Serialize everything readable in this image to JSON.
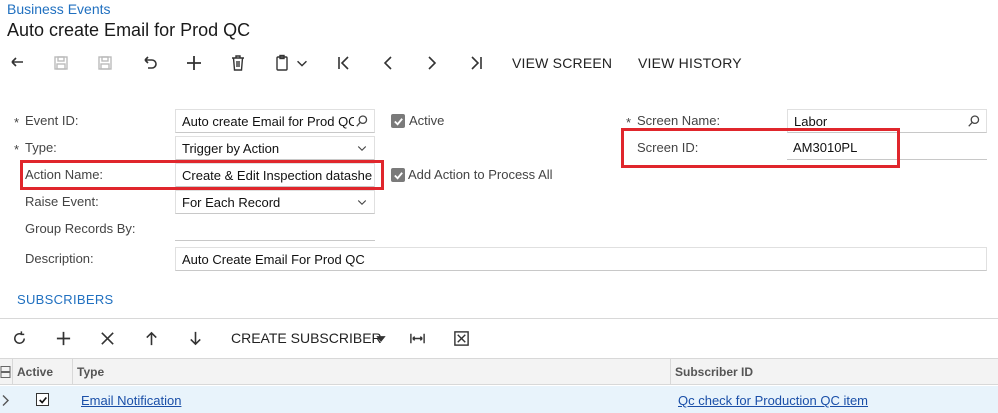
{
  "breadcrumb": "Business Events",
  "title": "Auto create Email for Prod QC",
  "toolbar": {
    "view_screen": "VIEW SCREEN",
    "view_history": "VIEW HISTORY"
  },
  "form": {
    "event_id": {
      "label": "Event ID:",
      "required": "*",
      "value": "Auto create Email for Prod QC"
    },
    "active": {
      "label": "Active",
      "checked": true
    },
    "type": {
      "label": "Type:",
      "required": "*",
      "value": "Trigger by Action"
    },
    "action_name": {
      "label": "Action Name:",
      "value": "Create & Edit Inspection datashe"
    },
    "add_action": {
      "label": "Add Action to Process All",
      "checked": true
    },
    "raise_event": {
      "label": "Raise Event:",
      "value": "For Each Record"
    },
    "group_records_by": {
      "label": "Group Records By:",
      "value": ""
    },
    "description": {
      "label": "Description:",
      "value": "Auto Create Email For Prod QC"
    },
    "screen_name": {
      "label": "Screen Name:",
      "required": "*",
      "value": "Labor"
    },
    "screen_id": {
      "label": "Screen ID:",
      "value": "AM3010PL"
    }
  },
  "tabs": {
    "subscribers": "SUBSCRIBERS"
  },
  "grid_toolbar": {
    "create_subscriber": "CREATE SUBSCRIBER"
  },
  "grid": {
    "columns": {
      "active": "Active",
      "type": "Type",
      "subscriber_id": "Subscriber ID"
    },
    "rows": [
      {
        "active": true,
        "type": "Email Notification",
        "subscriber_id": "Qc check for Production QC item"
      }
    ]
  },
  "colors": {
    "accent": "#2070c0",
    "highlight": "#e0262c",
    "row_selected": "#e8f3fb"
  }
}
